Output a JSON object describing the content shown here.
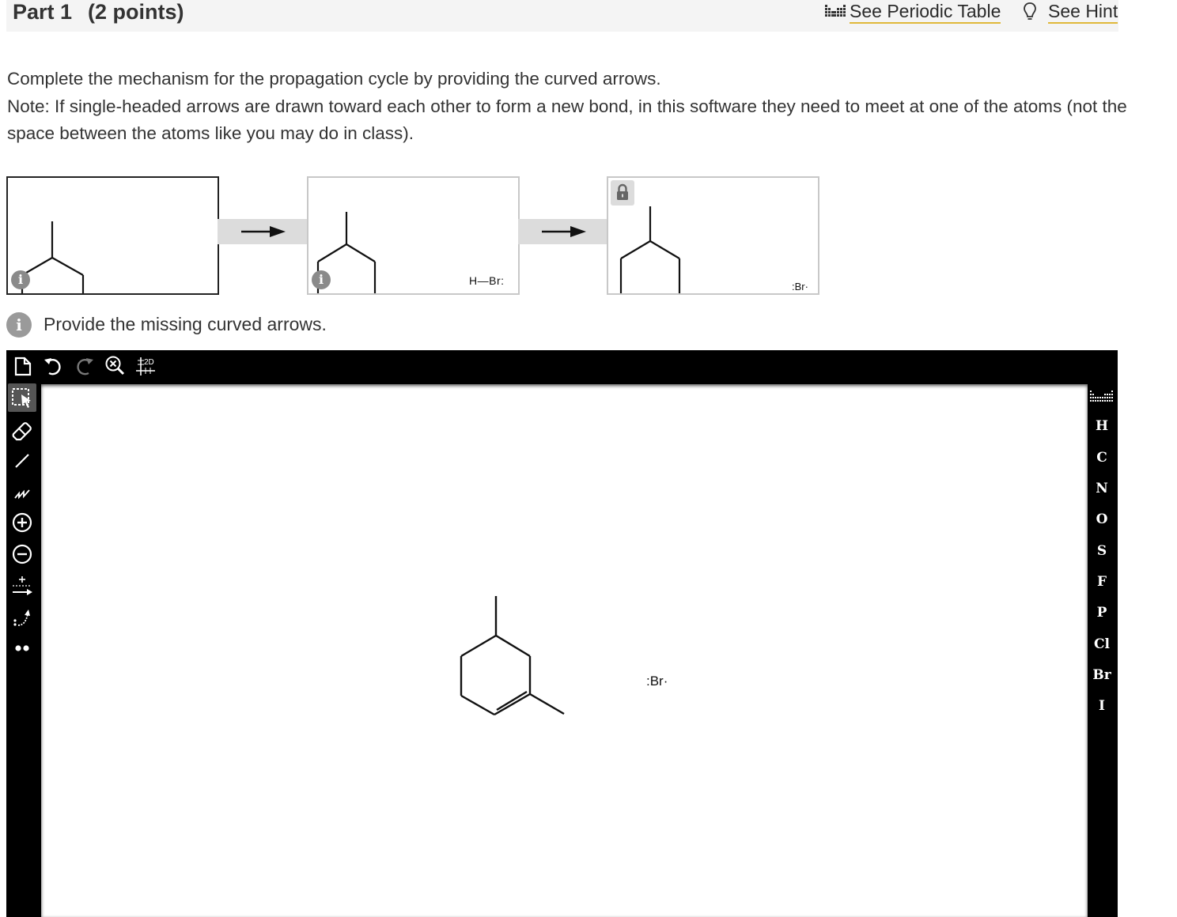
{
  "header": {
    "part_label": "Part 1",
    "points_label": "(2 points)",
    "periodic_table_link": "See Periodic Table",
    "hint_link": "See Hint"
  },
  "instructions": {
    "line1": "Complete the mechanism for the propagation cycle by providing the curved arrows.",
    "line2": "Note: If single-headed arrows are drawn toward each other to form a new bond, in this software they need to meet at one of the atoms (not the space between the atoms like you may do in class)."
  },
  "mechanism_panels": [
    {
      "id": "step-1",
      "reagent": "",
      "locked": false,
      "active": true
    },
    {
      "id": "step-2",
      "reagent": "H—Br:",
      "locked": false,
      "active": false
    },
    {
      "id": "step-3",
      "reagent": ":Br·",
      "locked": true,
      "active": false
    }
  ],
  "hint_message": "Provide the missing curved arrows.",
  "editor": {
    "top_tools": [
      "new-document",
      "undo",
      "redo",
      "zoom-reset",
      "2d-clean"
    ],
    "top_tool_text": {
      "clean2d": "2D"
    },
    "side_tools": [
      "selection",
      "eraser",
      "single-bond",
      "chain",
      "positive-charge",
      "negative-charge",
      "electron-arrow",
      "curved-arrow",
      "lone-pair"
    ],
    "elements": [
      "H",
      "C",
      "N",
      "O",
      "S",
      "F",
      "P",
      "Cl",
      "Br",
      "I"
    ],
    "canvas_reagent": ":Br·"
  },
  "colors": {
    "header_bg": "#f4f4f4",
    "link_underline": "#e0b83a",
    "editor_bg": "#000000",
    "arrow_band": "#dcdcdc"
  }
}
